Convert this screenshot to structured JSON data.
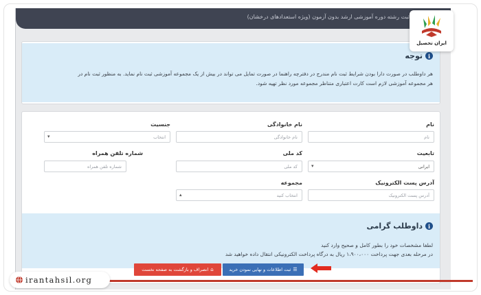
{
  "header": {
    "title": "ثبت رشته دوره آموزشی ارشد بدون آزمون (ویژه استعدادهای درخشان)"
  },
  "notice": {
    "title": "توجه",
    "text_line1": "هر داوطلب در صورت دارا بودن شرایط ثبت نام مندرج در دفترچه راهنما در صورت تمایل می تواند در بیش از یک مجموعه آموزشی ثبت نام نماید. به منظور ثبت نام در",
    "text_line2": "هر مجموعه آموزشی لازم است کارت اعتباری متناظر مجموعه مورد نظر تهیه شود."
  },
  "form": {
    "first_name": {
      "label": "نام",
      "placeholder": "نام"
    },
    "last_name": {
      "label": "نام خانوادگی",
      "placeholder": "نام خانوادگی"
    },
    "gender": {
      "label": "جنسیت",
      "value": "انتخاب"
    },
    "nationality": {
      "label": "تابعیت",
      "value": "ایرانی"
    },
    "national_code": {
      "label": "کد ملی",
      "placeholder": "کد ملی"
    },
    "phone": {
      "label": "شماره تلفن همراه",
      "placeholder": "شماره تلفن همراه"
    },
    "email": {
      "label": "آدرس پست الکترونیک",
      "placeholder": "آدرس پست الکترونیک"
    },
    "group": {
      "label": "مجموعه",
      "value": "انتخاب کنید"
    }
  },
  "candidate_box": {
    "title": "داوطلب گرامی",
    "line1": "لطفا مشخصات خود را بطور کامل و صحیح وارد کنید",
    "line2": "در مرحله بعدی جهت پرداخت ۱،۹۰۰،۰۰۰ ریال به درگاه پرداخت الکترونیکی انتقال داده خواهید شد"
  },
  "buttons": {
    "submit": "ثبت اطلاعات و نهایی نمودن خرید",
    "cancel": "انصراف و بازگشت به صفحه نخست"
  },
  "branding": {
    "logo_text": "ایران تحصیل",
    "site": "irantahsil.org"
  },
  "colors": {
    "submit_button": "#3b6fb6",
    "cancel_button": "#e0463a",
    "accent_line": "#c0392b",
    "info_bg": "#d9ecf8"
  },
  "icons": {
    "info": "info-circle-icon",
    "submit": "list-icon",
    "cancel": "home-icon",
    "arrow": "red-arrow-icon",
    "globe": "globe-icon"
  }
}
